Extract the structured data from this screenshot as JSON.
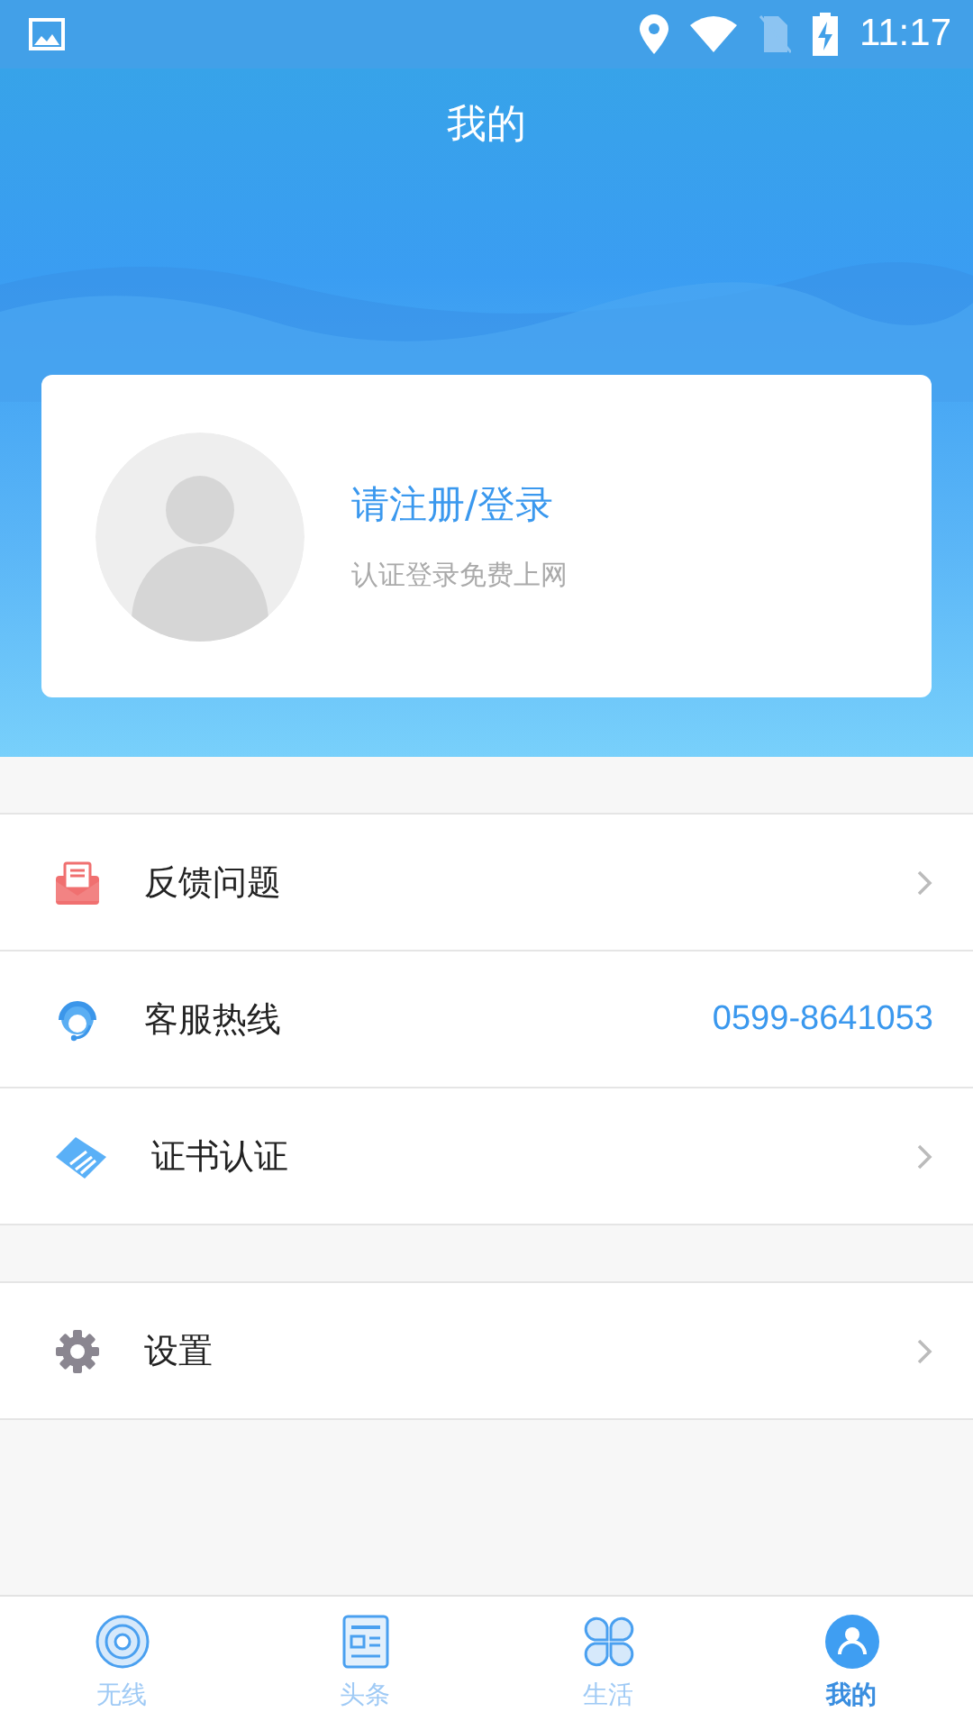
{
  "status_bar": {
    "time": "11:17"
  },
  "header": {
    "title": "我的"
  },
  "profile": {
    "login": "请注册/登录",
    "hint": "认证登录免费上网"
  },
  "menu_groups": [
    {
      "items": [
        {
          "kind": "feedback",
          "label": "反馈问题",
          "chevron": true
        },
        {
          "kind": "hotline",
          "label": "客服热线",
          "value": "0599-8641053",
          "chevron": false
        },
        {
          "kind": "certificate",
          "label": "证书认证",
          "chevron": true
        }
      ]
    },
    {
      "items": [
        {
          "kind": "settings",
          "label": "设置",
          "chevron": true
        }
      ]
    }
  ],
  "tabs": [
    {
      "kind": "wireless",
      "label": "无线",
      "selected": false
    },
    {
      "kind": "news",
      "label": "头条",
      "selected": false
    },
    {
      "kind": "life",
      "label": "生活",
      "selected": false
    },
    {
      "kind": "me",
      "label": "我的",
      "selected": true
    }
  ]
}
